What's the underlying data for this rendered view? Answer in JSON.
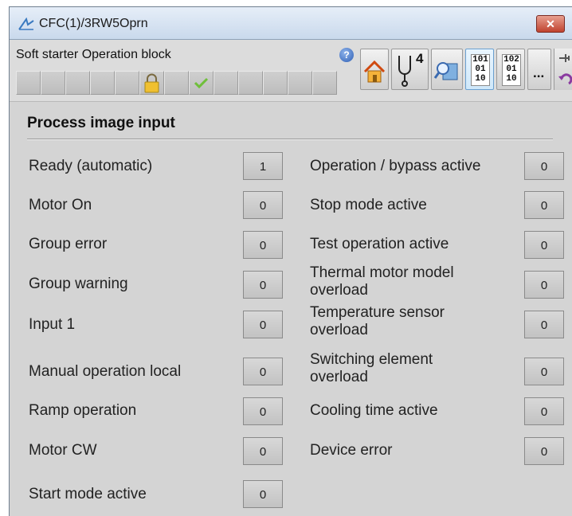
{
  "window": {
    "title": "CFC(1)/3RW5Oprn",
    "close_label": "✕"
  },
  "toolbar": {
    "block_title": "Soft starter Operation block",
    "help_label": "?",
    "channel_number": "4",
    "binary_btn1": {
      "l1": "10",
      "l1b": "1",
      "l2": "01",
      "l3": "10"
    },
    "binary_btn2": {
      "l1": "10",
      "l1b": "2",
      "l2": "01",
      "l3": "10"
    },
    "more_label": "..."
  },
  "section": {
    "title": "Process image input"
  },
  "left_items": [
    {
      "label": "Ready (automatic)",
      "value": "1"
    },
    {
      "label": "Motor On",
      "value": "0"
    },
    {
      "label": "Group error",
      "value": "0"
    },
    {
      "label": "Group warning",
      "value": "0"
    },
    {
      "label": "Input 1",
      "value": "0"
    },
    {
      "label": "Manual operation local",
      "value": "0"
    },
    {
      "label": "Ramp operation",
      "value": "0"
    },
    {
      "label": "Motor CW",
      "value": "0"
    },
    {
      "label": "Start mode active",
      "value": "0"
    }
  ],
  "right_items": [
    {
      "label": "Operation / bypass active",
      "value": "0"
    },
    {
      "label": "Stop mode active",
      "value": "0"
    },
    {
      "label": "Test operation active",
      "value": "0"
    },
    {
      "label1": "Thermal motor model",
      "label2": "overload",
      "value": "0"
    },
    {
      "label1": "Temperature sensor",
      "label2": "overload",
      "value": "0"
    },
    {
      "label1": "Switching element",
      "label2": "overload",
      "value": "0"
    },
    {
      "label": "Cooling time active",
      "value": "0"
    },
    {
      "label": "Device error",
      "value": "0"
    }
  ],
  "icons": {
    "title": "signal-icon",
    "lock": "padlock-icon",
    "check": "checkmark-icon",
    "home": "home-icon",
    "probe": "stethoscope-icon",
    "magnifier": "magnifier-icon",
    "side_top": "pin-icon",
    "side_bottom": "undo-icon"
  },
  "colors": {
    "titlebar": "#c9d9ec",
    "close": "#c0432f",
    "panel": "#d4d4d4",
    "lock": "#f0c030",
    "check": "#6fbf3a"
  }
}
